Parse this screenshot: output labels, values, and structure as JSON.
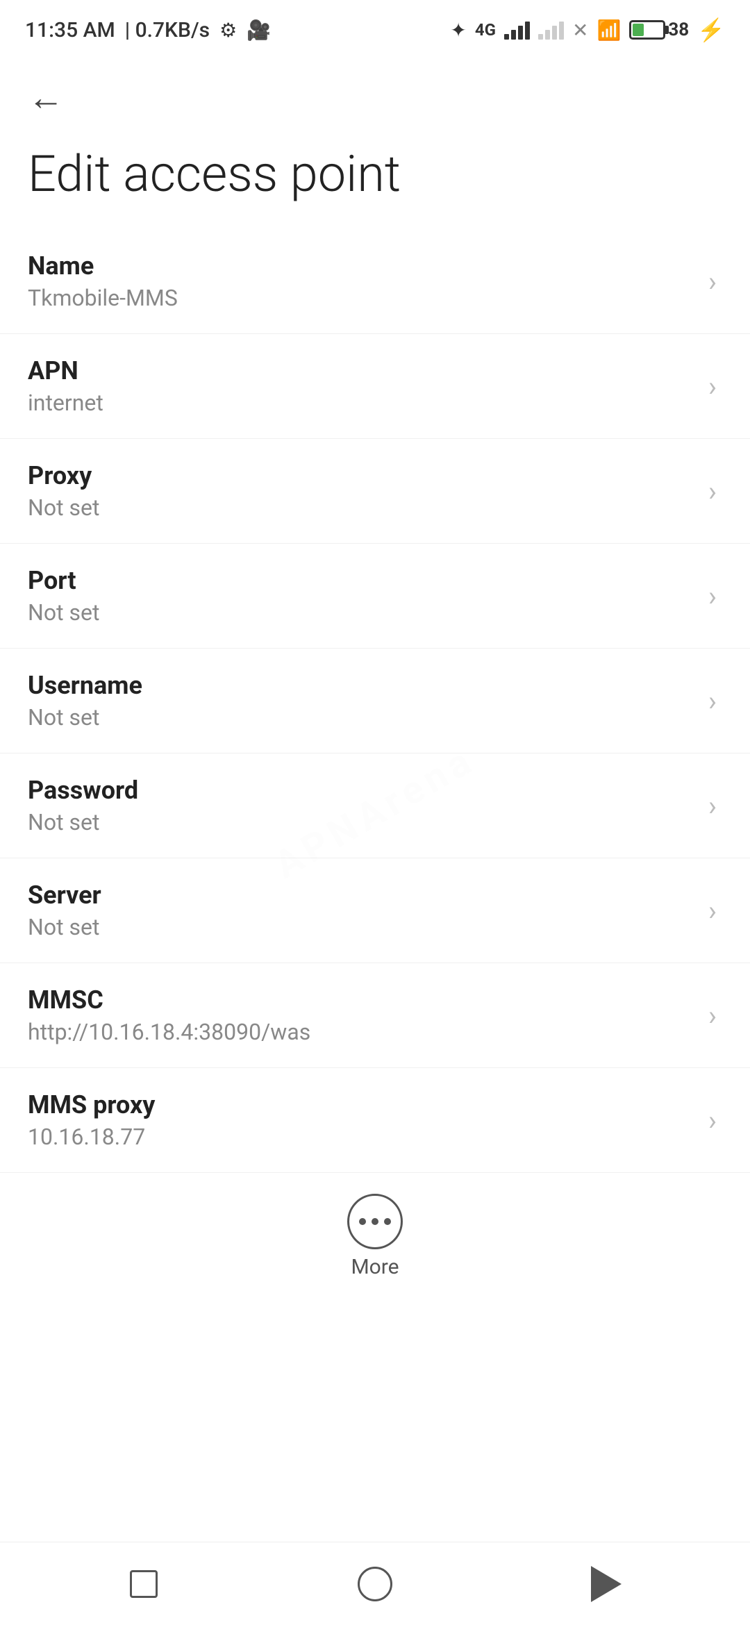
{
  "statusBar": {
    "time": "11:35 AM",
    "speed": "0.7KB/s"
  },
  "header": {
    "backLabel": "←",
    "title": "Edit access point"
  },
  "settings": {
    "items": [
      {
        "label": "Name",
        "value": "Tkmobile-MMS"
      },
      {
        "label": "APN",
        "value": "internet"
      },
      {
        "label": "Proxy",
        "value": "Not set"
      },
      {
        "label": "Port",
        "value": "Not set"
      },
      {
        "label": "Username",
        "value": "Not set"
      },
      {
        "label": "Password",
        "value": "Not set"
      },
      {
        "label": "Server",
        "value": "Not set"
      },
      {
        "label": "MMSC",
        "value": "http://10.16.18.4:38090/was"
      },
      {
        "label": "MMS proxy",
        "value": "10.16.18.77"
      }
    ]
  },
  "more": {
    "label": "More"
  },
  "watermark": {
    "text": "APNArena"
  }
}
